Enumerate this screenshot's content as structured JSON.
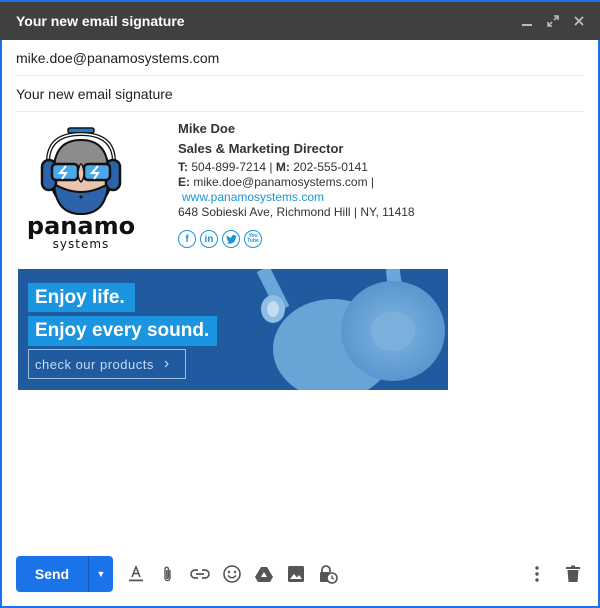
{
  "window": {
    "title": "Your new email signature",
    "controls": [
      "minimize",
      "expand",
      "close"
    ]
  },
  "compose": {
    "to": "mike.doe@panamosystems.com",
    "subject": "Your new email signature"
  },
  "signature": {
    "logo": {
      "brand": "panamo",
      "tagline": "systems"
    },
    "name": "Mike Doe",
    "role": "Sales & Marketing Director",
    "phone_label": "T:",
    "phone": "504-899-7214",
    "separator": "|",
    "mobile_label": "M:",
    "mobile": "202-555-0141",
    "email_label": "E:",
    "email": "mike.doe@panamosystems.com |",
    "website": "www.panamosystems.com",
    "address": "648 Sobieski Ave, Richmond Hill | NY, 11418",
    "socials": [
      {
        "name": "facebook",
        "glyph": "f"
      },
      {
        "name": "linkedin",
        "glyph": "in"
      },
      {
        "name": "twitter",
        "glyph": "🐦"
      },
      {
        "name": "youtube",
        "glyph": "You Tube"
      }
    ]
  },
  "banner": {
    "line1": "Enjoy life.",
    "line2": "Enjoy every sound.",
    "cta": "check our products",
    "cta_chevron": "›",
    "colors": {
      "background": "#1f5b9e",
      "highlight": "#1b95e0"
    }
  },
  "toolbar": {
    "send_label": "Send",
    "more_send_glyph": "▼",
    "tools": [
      "formatting",
      "attach-file",
      "insert-link",
      "insert-emoji",
      "google-drive",
      "insert-photo",
      "confidential-mode"
    ],
    "right_tools": [
      "more-options",
      "discard-draft"
    ]
  },
  "colors": {
    "accent": "#1a73e8",
    "titlebar": "#404040",
    "link": "#1b95d6"
  }
}
